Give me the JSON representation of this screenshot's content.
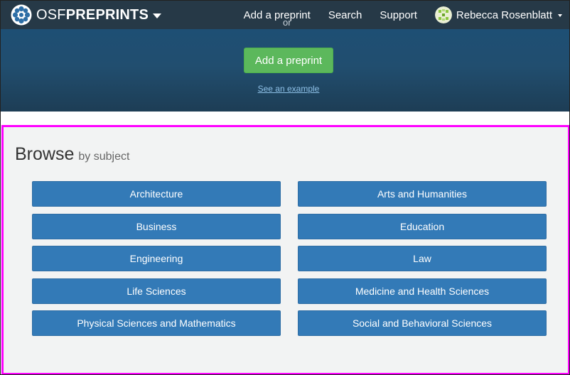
{
  "navbar": {
    "brand_osf": "OSF",
    "brand_preprints": "PREPRINTS",
    "links": [
      "Add a preprint",
      "Search",
      "Support"
    ],
    "user_name": "Rebecca Rosenblatt"
  },
  "hero": {
    "clipped_text": "or",
    "add_button": "Add a preprint",
    "example_link": "See an example"
  },
  "browse": {
    "title": "Browse",
    "subtitle": "by subject",
    "subjects": [
      "Architecture",
      "Arts and Humanities",
      "Business",
      "Education",
      "Engineering",
      "Law",
      "Life Sciences",
      "Medicine and Health Sciences",
      "Physical Sciences and Mathematics",
      "Social and Behavioral Sciences"
    ]
  },
  "colors": {
    "navbar_bg": "#263947",
    "hero_bg": "#214e6f",
    "primary_button": "#337ab7",
    "success_button": "#5cb85c",
    "highlight_border": "#ff00ff"
  }
}
